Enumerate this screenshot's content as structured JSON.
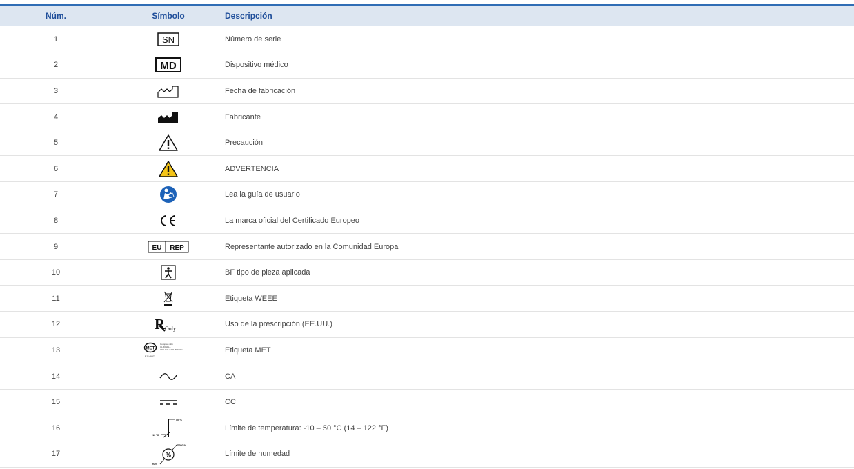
{
  "table": {
    "headers": {
      "num": "Núm.",
      "symbol": "Símbolo",
      "description": "Descripción"
    },
    "rows": [
      {
        "num": "1",
        "icon": "serial-number-icon",
        "icon_text": "SN",
        "description": "Número de serie"
      },
      {
        "num": "2",
        "icon": "medical-device-icon",
        "icon_text": "MD",
        "description": "Dispositivo médico"
      },
      {
        "num": "3",
        "icon": "date-of-manufacture-icon",
        "description": "Fecha de fabricación"
      },
      {
        "num": "4",
        "icon": "manufacturer-icon",
        "description": "Fabricante"
      },
      {
        "num": "5",
        "icon": "caution-icon",
        "description": "Precaución"
      },
      {
        "num": "6",
        "icon": "warning-icon",
        "description": "ADVERTENCIA"
      },
      {
        "num": "7",
        "icon": "read-user-guide-icon",
        "description": "Lea la guía de usuario"
      },
      {
        "num": "8",
        "icon": "ce-mark-icon",
        "description": "La marca oficial del Certificado Europeo"
      },
      {
        "num": "9",
        "icon": "eu-rep-icon",
        "icon_text_a": "EU",
        "icon_text_b": "REP",
        "description": "Representante autorizado en la Comunidad Europa"
      },
      {
        "num": "10",
        "icon": "bf-applied-part-icon",
        "description": "BF tipo de pieza aplicada"
      },
      {
        "num": "11",
        "icon": "weee-icon",
        "description": "Etiqueta WEEE"
      },
      {
        "num": "12",
        "icon": "rx-only-icon",
        "icon_text_a": "R",
        "icon_text_b": "Only",
        "description": "Uso de la prescripción (EE.UU.)"
      },
      {
        "num": "13",
        "icon": "met-label-icon",
        "icon_text_a": "MET",
        "icon_text_b": "Complies with",
        "icon_text_c": "UL 60601-1",
        "icon_text_d": "CSA C22.2 NO. 60601-1",
        "icon_text_e": "E114997",
        "description": "Etiqueta MET"
      },
      {
        "num": "14",
        "icon": "alternating-current-icon",
        "description": "CA"
      },
      {
        "num": "15",
        "icon": "direct-current-icon",
        "description": "CC"
      },
      {
        "num": "16",
        "icon": "temperature-limit-icon",
        "icon_text_a": "50 °C",
        "icon_text_b": "-10 °C",
        "description": "Límite de temperatura: -10 – 50 °C (14 – 122 °F)"
      },
      {
        "num": "17",
        "icon": "humidity-limit-icon",
        "icon_text_a": "80 %",
        "icon_text_b": "20%",
        "icon_text_c": "%",
        "description": "Límite de humedad"
      }
    ]
  },
  "colors": {
    "header_bg": "#dde6f1",
    "header_text": "#1f4e9a",
    "accent_line": "#2f6db5",
    "warning_yellow": "#f5c518",
    "info_blue": "#1d62b8"
  }
}
